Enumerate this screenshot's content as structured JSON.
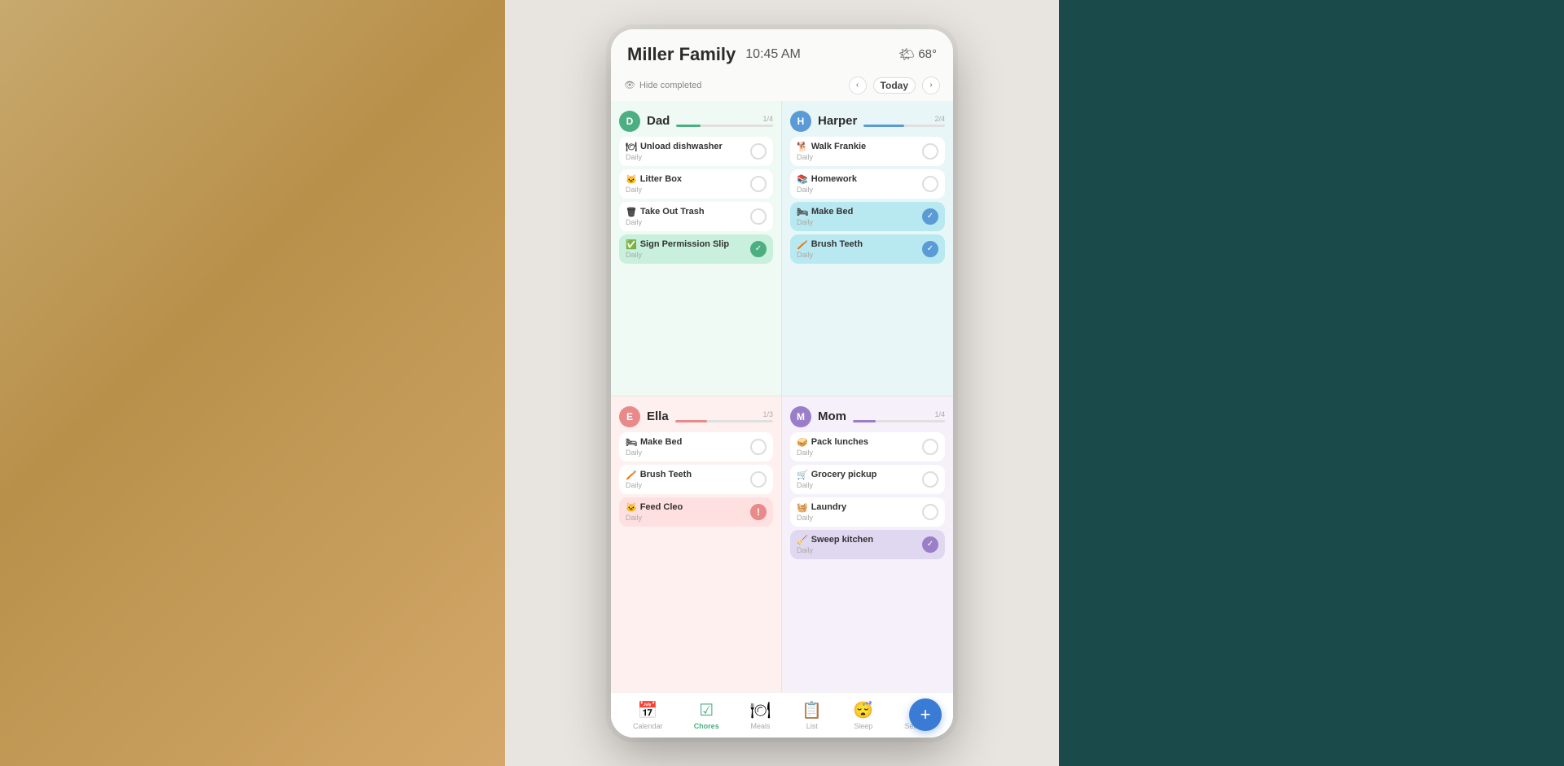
{
  "app": {
    "family_name": "Miller Family",
    "time": "10:45 AM",
    "weather_icon": "🌤",
    "temperature": "68°",
    "hide_completed_label": "Hide completed",
    "today_label": "Today"
  },
  "people": {
    "dad": {
      "name": "Dad",
      "avatar_letter": "D",
      "progress": "1/4",
      "chores": [
        {
          "emoji": "🍽",
          "name": "Unload dishwasher",
          "freq": "Daily",
          "status": "pending"
        },
        {
          "emoji": "🐱",
          "name": "Litter Box",
          "freq": "Daily",
          "status": "pending"
        },
        {
          "emoji": "🗑",
          "name": "Take Out Trash",
          "freq": "Daily",
          "status": "pending"
        },
        {
          "emoji": "✅",
          "name": "Sign Permission Slip",
          "freq": "Daily",
          "status": "done-green"
        }
      ]
    },
    "harper": {
      "name": "Harper",
      "avatar_letter": "H",
      "progress": "2/4",
      "chores": [
        {
          "emoji": "🐕",
          "name": "Walk Frankie",
          "freq": "Daily",
          "status": "pending"
        },
        {
          "emoji": "📚",
          "name": "Homework",
          "freq": "Daily",
          "status": "pending"
        },
        {
          "emoji": "🛏",
          "name": "Make Bed",
          "freq": "Daily",
          "status": "done"
        },
        {
          "emoji": "🪥",
          "name": "Brush Teeth",
          "freq": "Daily",
          "status": "done"
        }
      ]
    },
    "ella": {
      "name": "Ella",
      "avatar_letter": "E",
      "progress": "1/3",
      "chores": [
        {
          "emoji": "🛏",
          "name": "Make Bed",
          "freq": "Daily",
          "status": "pending"
        },
        {
          "emoji": "🪥",
          "name": "Brush Teeth",
          "freq": "Daily",
          "status": "pending"
        },
        {
          "emoji": "🐱",
          "name": "Feed Cleo",
          "freq": "Daily",
          "status": "overdue"
        }
      ]
    },
    "mom": {
      "name": "Mom",
      "avatar_letter": "M",
      "progress": "1/4",
      "chores": [
        {
          "emoji": "🥪",
          "name": "Pack lunches",
          "freq": "Daily",
          "status": "pending"
        },
        {
          "emoji": "🛒",
          "name": "Grocery pickup",
          "freq": "Daily",
          "status": "pending"
        },
        {
          "emoji": "🧺",
          "name": "Laundry",
          "freq": "Daily",
          "status": "pending"
        },
        {
          "emoji": "🧹",
          "name": "Sweep kitchen",
          "freq": "Daily",
          "status": "done-purple"
        }
      ]
    }
  },
  "nav": {
    "items": [
      {
        "icon": "📅",
        "label": "Calendar",
        "active": false
      },
      {
        "icon": "✔",
        "label": "Chores",
        "active": true
      },
      {
        "icon": "🍽",
        "label": "Meals",
        "active": false
      },
      {
        "icon": "📋",
        "label": "List",
        "active": false
      },
      {
        "icon": "😴",
        "label": "Sleep",
        "active": false
      },
      {
        "icon": "⚙",
        "label": "Settings",
        "active": false
      }
    ],
    "fab_icon": "+"
  }
}
